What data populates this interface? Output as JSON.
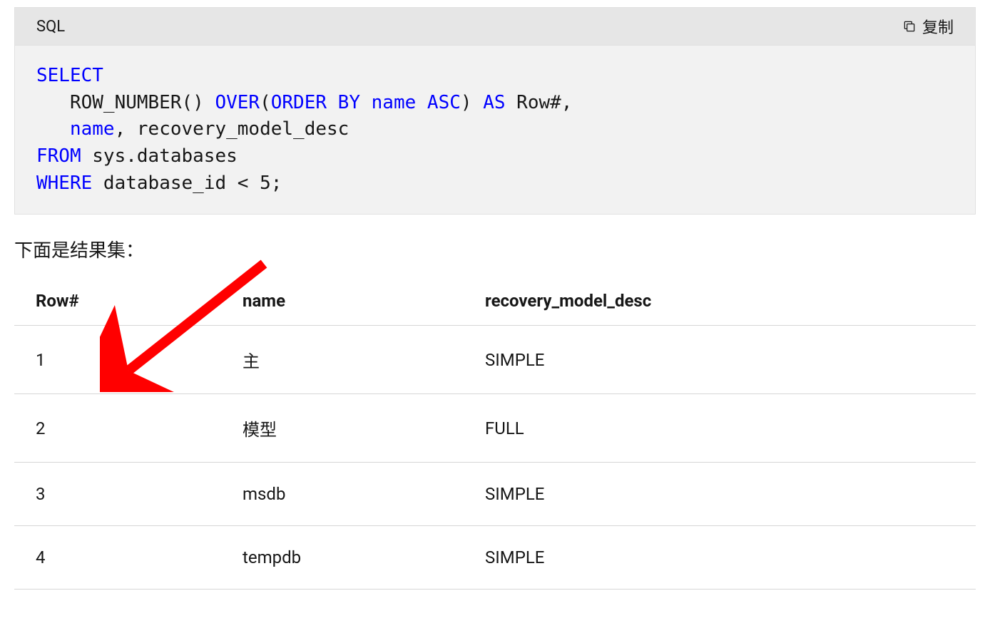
{
  "code_block": {
    "language_label": "SQL",
    "copy_label": "复制",
    "tokens": [
      {
        "t": "SELECT",
        "c": "kw"
      },
      {
        "t": "\n   ROW_NUMBER() ",
        "c": "plain"
      },
      {
        "t": "OVER",
        "c": "kw"
      },
      {
        "t": "(",
        "c": "plain"
      },
      {
        "t": "ORDER",
        "c": "kw"
      },
      {
        "t": " ",
        "c": "plain"
      },
      {
        "t": "BY",
        "c": "kw"
      },
      {
        "t": " ",
        "c": "plain"
      },
      {
        "t": "name",
        "c": "kw"
      },
      {
        "t": " ",
        "c": "plain"
      },
      {
        "t": "ASC",
        "c": "kw"
      },
      {
        "t": ") ",
        "c": "plain"
      },
      {
        "t": "AS",
        "c": "kw"
      },
      {
        "t": " Row#,\n   ",
        "c": "plain"
      },
      {
        "t": "name",
        "c": "kw"
      },
      {
        "t": ", recovery_model_desc\n",
        "c": "plain"
      },
      {
        "t": "FROM",
        "c": "kw"
      },
      {
        "t": " sys.databases\n",
        "c": "plain"
      },
      {
        "t": "WHERE",
        "c": "kw"
      },
      {
        "t": " database_id < ",
        "c": "plain"
      },
      {
        "t": "5",
        "c": "plain"
      },
      {
        "t": ";",
        "c": "plain"
      }
    ]
  },
  "result_label": "下面是结果集：",
  "table": {
    "headers": [
      "Row#",
      "name",
      "recovery_model_desc"
    ],
    "rows": [
      [
        "1",
        "主",
        "SIMPLE"
      ],
      [
        "2",
        "模型",
        "FULL"
      ],
      [
        "3",
        "msdb",
        "SIMPLE"
      ],
      [
        "4",
        "tempdb",
        "SIMPLE"
      ]
    ]
  },
  "annotation": {
    "color": "#ff0000"
  }
}
